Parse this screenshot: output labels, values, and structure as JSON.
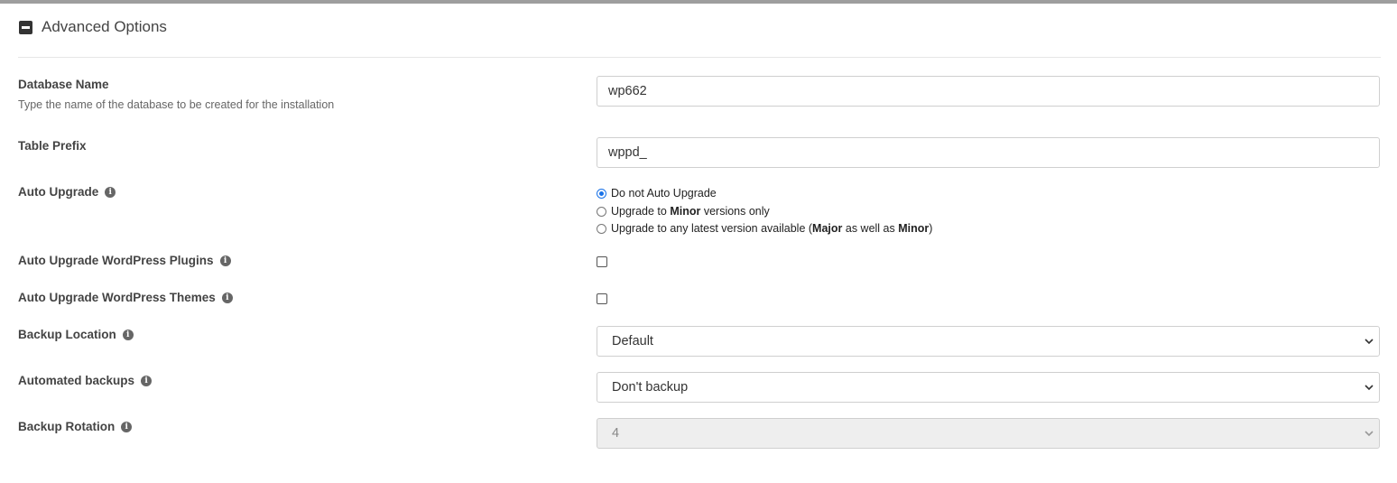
{
  "section": {
    "title": "Advanced Options"
  },
  "fields": {
    "database_name": {
      "label": "Database Name",
      "description": "Type the name of the database to be created for the installation",
      "value": "wp662"
    },
    "table_prefix": {
      "label": "Table Prefix",
      "value": "wppd_"
    },
    "auto_upgrade": {
      "label": "Auto Upgrade",
      "options": {
        "none": "Do not Auto Upgrade",
        "minor_pre": "Upgrade to ",
        "minor_bold": "Minor",
        "minor_post": " versions only",
        "latest_pre": "Upgrade to any latest version available (",
        "latest_bold1": "Major",
        "latest_mid": " as well as ",
        "latest_bold2": "Minor",
        "latest_post": ")"
      },
      "selected": "Do not Auto Upgrade"
    },
    "auto_upgrade_plugins": {
      "label": "Auto Upgrade WordPress Plugins",
      "checked": false
    },
    "auto_upgrade_themes": {
      "label": "Auto Upgrade WordPress Themes",
      "checked": false
    },
    "backup_location": {
      "label": "Backup Location",
      "value": "Default"
    },
    "automated_backups": {
      "label": "Automated backups",
      "value": "Don't backup"
    },
    "backup_rotation": {
      "label": "Backup Rotation",
      "value": "4",
      "disabled": true
    }
  },
  "icons": {
    "section_toggle": "collapse-minus-icon",
    "info": "info-icon",
    "select_arrow": "chevron-down-icon"
  },
  "colors": {
    "accent": "#1a73e8",
    "topbar": "#9e9e9e"
  }
}
